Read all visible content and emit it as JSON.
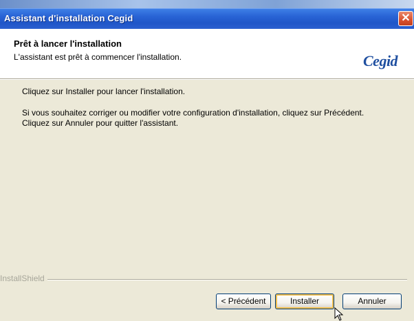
{
  "window": {
    "title": "Assistant d'installation Cegid",
    "close_glyph": "✕"
  },
  "header": {
    "title": "Prêt à lancer l'installation",
    "subtitle": "L'assistant est prêt à commencer l'installation.",
    "logo_text": "Cegid"
  },
  "body": {
    "line1": "Cliquez sur Installer pour lancer l'installation.",
    "line2": "Si vous souhaitez corriger ou modifier votre configuration d'installation, cliquez sur Précédent.",
    "line3": "Cliquez sur Annuler pour quitter l'assistant."
  },
  "footer": {
    "brand": "InstallShield",
    "back_label": "< Précédent",
    "install_label": "Installer",
    "cancel_label": "Annuler"
  },
  "colors": {
    "titlebar": "#2a65d6",
    "close": "#d9512f",
    "dialog_bg": "#ece9d8",
    "default_button_ring": "#f1bf4f"
  }
}
